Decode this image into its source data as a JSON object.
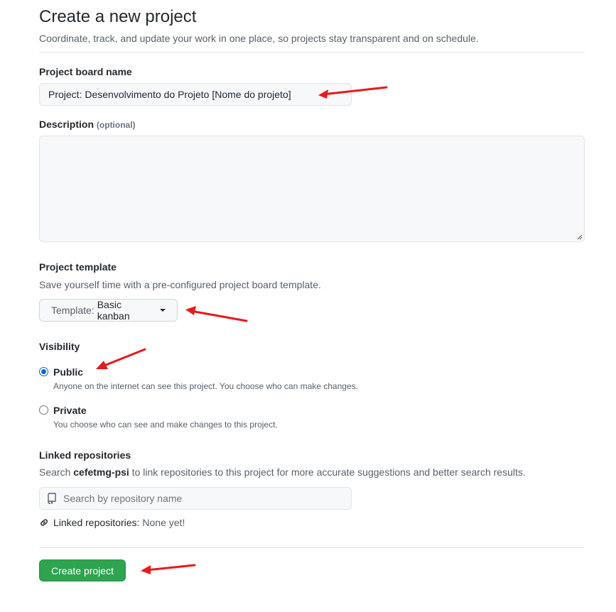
{
  "header": {
    "title": "Create a new project",
    "subtitle": "Coordinate, track, and update your work in one place, so projects stay transparent and on schedule."
  },
  "board_name": {
    "label": "Project board name",
    "value": "Project: Desenvolvimento do Projeto [Nome do projeto]"
  },
  "description": {
    "label": "Description",
    "optional": "(optional)",
    "value": ""
  },
  "template": {
    "label": "Project template",
    "note": "Save yourself time with a pre-configured project board template.",
    "button_prefix": "Template:",
    "button_value": "Basic kanban"
  },
  "visibility": {
    "label": "Visibility",
    "options": [
      {
        "title": "Public",
        "desc": "Anyone on the internet can see this project. You choose who can make changes.",
        "checked": true
      },
      {
        "title": "Private",
        "desc": "You choose who can see and make changes to this project.",
        "checked": false
      }
    ]
  },
  "linked": {
    "label": "Linked repositories",
    "note_prefix": "Search",
    "org": "cefetmg-psi",
    "note_suffix": "to link repositories to this project for more accurate suggestions and better search results.",
    "search_placeholder": "Search by repository name",
    "status_label": "Linked repositories:",
    "status_value": "None yet!"
  },
  "submit": {
    "label": "Create project"
  },
  "colors": {
    "accent_blue": "#0366d6",
    "submit_green": "#2ea44f",
    "annotation_red": "#e8191c"
  }
}
